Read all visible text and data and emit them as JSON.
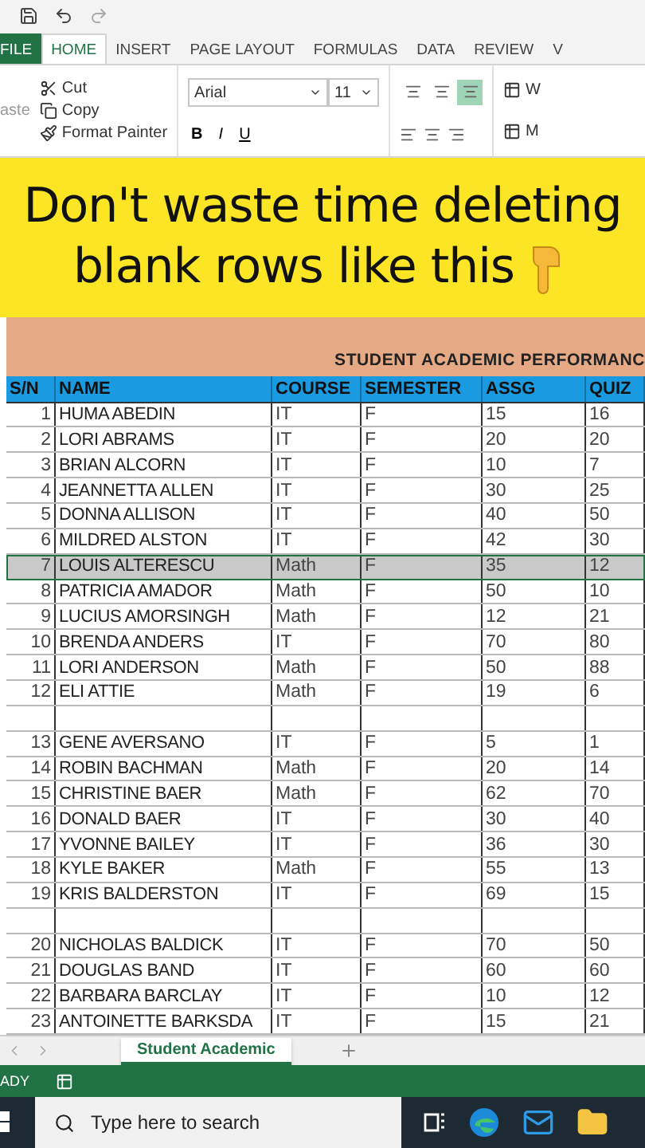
{
  "ribbon": {
    "tabs": [
      {
        "label": "FILE",
        "kind": "file",
        "selected": false
      },
      {
        "label": "HOME",
        "kind": "tab",
        "selected": true
      },
      {
        "label": "INSERT",
        "kind": "tab",
        "selected": false
      },
      {
        "label": "PAGE LAYOUT",
        "kind": "tab",
        "selected": false
      },
      {
        "label": "FORMULAS",
        "kind": "tab",
        "selected": false
      },
      {
        "label": "DATA",
        "kind": "tab",
        "selected": false
      },
      {
        "label": "REVIEW",
        "kind": "tab",
        "selected": false
      },
      {
        "label": "V",
        "kind": "tab",
        "selected": false
      }
    ],
    "clipboard": {
      "paste_label": "aste",
      "items": [
        "Cut",
        "Copy",
        "Format Painter"
      ]
    },
    "font": {
      "name": "Arial",
      "size": "11",
      "styles": [
        "B",
        "I",
        "U"
      ]
    },
    "vertical_align": [
      {
        "selected": false
      },
      {
        "selected": false
      },
      {
        "selected": true
      }
    ],
    "wrap_label": "W",
    "merge_label": "M"
  },
  "caption": {
    "lines": [
      "Don't waste time deleting",
      "blank rows like this"
    ]
  },
  "sheet": {
    "title": "STUDENT ACADEMIC PERFORMANC",
    "columns": [
      "S/N",
      "NAME",
      "COURSE",
      "SEMESTER",
      "ASSG",
      "QUIZ"
    ],
    "rows": [
      {
        "kind": "data",
        "selected": false,
        "cells": [
          "1",
          "HUMA ABEDIN",
          "IT",
          "F",
          "15",
          "16"
        ]
      },
      {
        "kind": "data",
        "selected": false,
        "cells": [
          "2",
          "LORI ABRAMS",
          "IT",
          "F",
          "20",
          "20"
        ]
      },
      {
        "kind": "data",
        "selected": false,
        "cells": [
          "3",
          "BRIAN ALCORN",
          "IT",
          "F",
          "10",
          "7"
        ]
      },
      {
        "kind": "data",
        "selected": false,
        "cells": [
          "4",
          "JEANNETTA ALLEN",
          "IT",
          "F",
          "30",
          "25"
        ]
      },
      {
        "kind": "data",
        "selected": false,
        "cells": [
          "5",
          "DONNA ALLISON",
          "IT",
          "F",
          "40",
          "50"
        ]
      },
      {
        "kind": "data",
        "selected": false,
        "cells": [
          "6",
          "MILDRED ALSTON",
          "IT",
          "F",
          "42",
          "30"
        ]
      },
      {
        "kind": "data",
        "selected": true,
        "cells": [
          "7",
          "LOUIS ALTERESCU",
          "Math",
          "F",
          "35",
          "12"
        ]
      },
      {
        "kind": "data",
        "selected": false,
        "cells": [
          "8",
          "PATRICIA AMADOR",
          "Math",
          "F",
          "50",
          "10"
        ]
      },
      {
        "kind": "data",
        "selected": false,
        "cells": [
          "9",
          "LUCIUS AMORSINGH",
          "Math",
          "F",
          "12",
          "21"
        ]
      },
      {
        "kind": "data",
        "selected": false,
        "cells": [
          "10",
          "BRENDA ANDERS",
          "IT",
          "F",
          "70",
          "80"
        ]
      },
      {
        "kind": "data",
        "selected": false,
        "cells": [
          "11",
          "LORI ANDERSON",
          "Math",
          "F",
          "50",
          "88"
        ]
      },
      {
        "kind": "data",
        "selected": false,
        "cells": [
          "12",
          "ELI ATTIE",
          "Math",
          "F",
          "19",
          "6"
        ]
      },
      {
        "kind": "blank",
        "selected": false
      },
      {
        "kind": "data",
        "selected": false,
        "cells": [
          "13",
          "GENE AVERSANO",
          "IT",
          "F",
          "5",
          "1"
        ]
      },
      {
        "kind": "data",
        "selected": false,
        "cells": [
          "14",
          "ROBIN BACHMAN",
          "Math",
          "F",
          "20",
          "14"
        ]
      },
      {
        "kind": "data",
        "selected": false,
        "cells": [
          "15",
          "CHRISTINE BAER",
          "Math",
          "F",
          "62",
          "70"
        ]
      },
      {
        "kind": "data",
        "selected": false,
        "cells": [
          "16",
          "DONALD BAER",
          "IT",
          "F",
          "30",
          "40"
        ]
      },
      {
        "kind": "data",
        "selected": false,
        "cells": [
          "17",
          "YVONNE BAILEY",
          "IT",
          "F",
          "36",
          "30"
        ]
      },
      {
        "kind": "data",
        "selected": false,
        "cells": [
          "18",
          "KYLE BAKER",
          "Math",
          "F",
          "55",
          "13"
        ]
      },
      {
        "kind": "data",
        "selected": false,
        "cells": [
          "19",
          "KRIS BALDERSTON",
          "IT",
          "F",
          "69",
          "15"
        ]
      },
      {
        "kind": "blank",
        "selected": false
      },
      {
        "kind": "data",
        "selected": false,
        "cells": [
          "20",
          "NICHOLAS BALDICK",
          "IT",
          "F",
          "70",
          "50"
        ]
      },
      {
        "kind": "data",
        "selected": false,
        "cells": [
          "21",
          "DOUGLAS BAND",
          "IT",
          "F",
          "60",
          "60"
        ]
      },
      {
        "kind": "data",
        "selected": false,
        "cells": [
          "22",
          "BARBARA BARCLAY",
          "IT",
          "F",
          "10",
          "12"
        ]
      },
      {
        "kind": "data",
        "selected": false,
        "cells": [
          "23",
          "ANTOINETTE BARKSDA",
          "IT",
          "F",
          "15",
          "21"
        ]
      }
    ]
  },
  "sheet_tabs": [
    {
      "label": "Student Academic",
      "selected": true
    }
  ],
  "status_bar": {
    "text": "ADY"
  },
  "taskbar": {
    "search_placeholder": "Type here to search"
  }
}
